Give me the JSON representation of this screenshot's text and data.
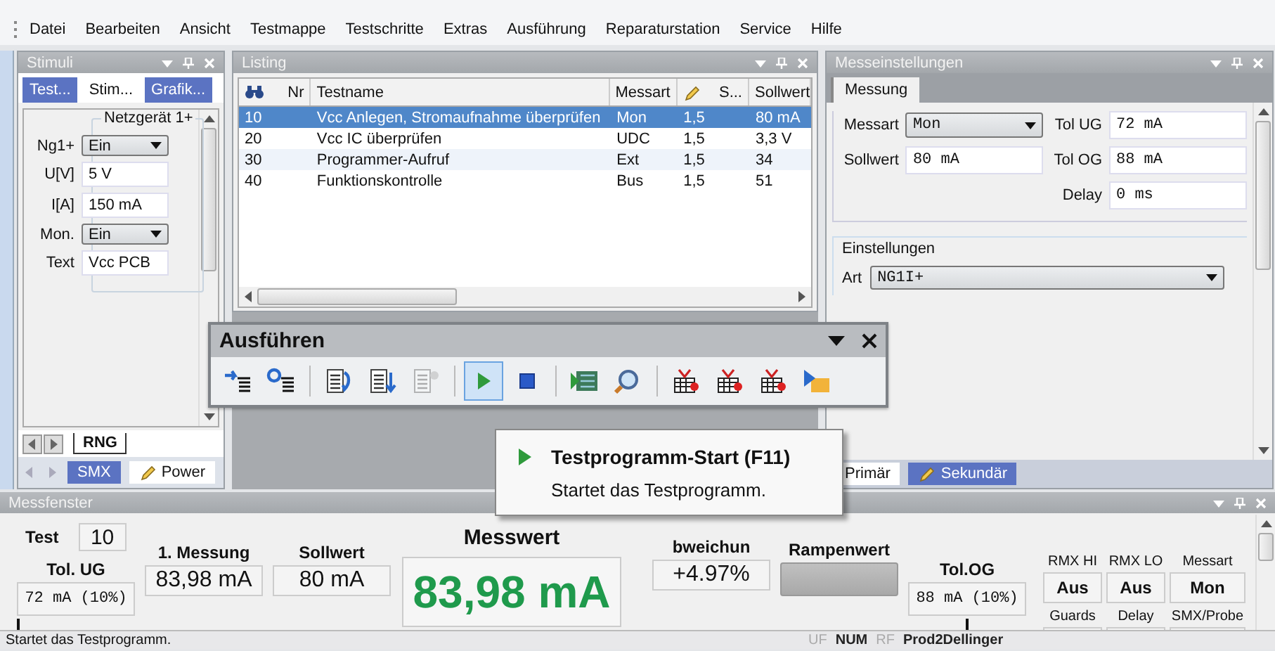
{
  "menu": [
    "Datei",
    "Bearbeiten",
    "Ansicht",
    "Testmappe",
    "Testschritte",
    "Extras",
    "Ausführung",
    "Reparaturstation",
    "Service",
    "Hilfe"
  ],
  "stimuli": {
    "title": "Stimuli",
    "tabs": [
      {
        "label": "Test...",
        "selected": false
      },
      {
        "label": "Stim...",
        "selected": true
      },
      {
        "label": "Grafik...",
        "selected": false
      }
    ],
    "group": "Netzgerät 1+",
    "fields": [
      {
        "kind": "dropdown",
        "label": "Ng1+",
        "value": "Ein"
      },
      {
        "kind": "text",
        "label": "U[V]",
        "value": "5 V"
      },
      {
        "kind": "text",
        "label": "I[A]",
        "value": "150 mA"
      },
      {
        "kind": "dropdown",
        "label": "Mon.",
        "value": "Ein"
      },
      {
        "kind": "text",
        "label": "Text",
        "value": "Vcc PCB"
      }
    ],
    "sheet_tabs": [
      {
        "label": "RNG",
        "selected": true
      }
    ],
    "bottom_tabs": [
      {
        "label": "SMX",
        "selected": false,
        "kind": "plain"
      },
      {
        "label": "Power",
        "selected": true,
        "kind": "edit"
      }
    ]
  },
  "listing": {
    "title": "Listing",
    "columns": [
      {
        "label": "Nr",
        "kind": "find"
      },
      {
        "label": "Testname",
        "kind": "plain"
      },
      {
        "label": "Messart",
        "kind": "plain"
      },
      {
        "label": "S...",
        "kind": "edit"
      },
      {
        "label": "Sollwert",
        "kind": "plain"
      }
    ],
    "rows": [
      {
        "cells": [
          "10",
          "Vcc Anlegen, Stromaufnahme überprüfen",
          "Mon",
          "1,5",
          "80 mA"
        ],
        "selected": true
      },
      {
        "cells": [
          "20",
          "Vcc IC überprüfen",
          "UDC",
          "1,5",
          "3,3 V"
        ],
        "selected": false
      },
      {
        "cells": [
          "30",
          "Programmer-Aufruf",
          "Ext",
          "1,5",
          "34"
        ],
        "selected": false
      },
      {
        "cells": [
          "40",
          "Funktionskontrolle",
          "Bus",
          "1,5",
          "51"
        ],
        "selected": false
      }
    ]
  },
  "settings": {
    "title": "Messeinstellungen",
    "tabs": [
      {
        "label": "Messung",
        "selected": true
      }
    ],
    "messart": {
      "label": "Messart",
      "value": "Mon"
    },
    "sollwert": {
      "label": "Sollwert",
      "value": "80 mA"
    },
    "tol_ug": {
      "label": "Tol UG",
      "value": "72 mA"
    },
    "tol_og": {
      "label": "Tol OG",
      "value": "88 mA"
    },
    "delay": {
      "label": "Delay",
      "value": "0 ms"
    },
    "group": "Einstellungen",
    "art": {
      "label": "Art",
      "value": "NG1I+"
    },
    "bottom_tabs": [
      {
        "label": "Primär",
        "selected": true,
        "kind": "plain"
      },
      {
        "label": "Sekundär",
        "selected": false,
        "kind": "edit"
      }
    ]
  },
  "toolbar": {
    "title": "Ausführen",
    "groups": [
      [
        {
          "kind": "step-arrow",
          "selected": false,
          "disabled": false
        },
        {
          "kind": "step-loop",
          "selected": false,
          "disabled": false
        }
      ],
      [
        {
          "kind": "doc-arrow",
          "selected": false,
          "disabled": false
        },
        {
          "kind": "doc-down",
          "selected": false,
          "disabled": false
        },
        {
          "kind": "doc-gear",
          "selected": false,
          "disabled": true
        }
      ],
      [
        {
          "kind": "play",
          "selected": true,
          "disabled": false
        },
        {
          "kind": "stop",
          "selected": false,
          "disabled": false
        }
      ],
      [
        {
          "kind": "board",
          "selected": false,
          "disabled": false
        },
        {
          "kind": "magnifier",
          "selected": false,
          "disabled": false
        }
      ],
      [
        {
          "kind": "stack",
          "selected": false,
          "disabled": false
        },
        {
          "kind": "stack",
          "selected": false,
          "disabled": false
        },
        {
          "kind": "stack",
          "selected": false,
          "disabled": false
        },
        {
          "kind": "folder",
          "selected": false,
          "disabled": false
        }
      ]
    ]
  },
  "tooltip": {
    "title": "Testprogramm-Start (F11)",
    "text": "Startet das Testprogramm."
  },
  "messfenster": {
    "title": "Messfenster",
    "test": {
      "label": "Test",
      "value": "10"
    },
    "tol_ug": {
      "label": "Tol. UG",
      "value": "72 mA (10%)"
    },
    "first": {
      "label": "1. Messung",
      "value": "83,98 mA"
    },
    "sollwert": {
      "label": "Sollwert",
      "value": "80 mA"
    },
    "messwert": {
      "label": "Messwert",
      "value": "83,98 mA"
    },
    "abweichung": {
      "label": "bweichun",
      "value": "+4.97%"
    },
    "rampe": {
      "label": "Rampenwert"
    },
    "tol_og": {
      "label": "Tol.OG",
      "value": "88 mA (10%)"
    },
    "flags": [
      {
        "label": "RMX HI",
        "value": "Aus"
      },
      {
        "label": "RMX LO",
        "value": "Aus"
      },
      {
        "label": "Messart",
        "value": "Mon"
      }
    ],
    "flags2": [
      {
        "label": "Guards"
      },
      {
        "label": "Delay"
      },
      {
        "label": "SMX/Probe"
      }
    ]
  },
  "status": {
    "message": "Startet das Testprogramm.",
    "indicators": [
      {
        "label": "UF",
        "on": false
      },
      {
        "label": "NUM",
        "on": true
      },
      {
        "label": "RF",
        "on": false
      },
      {
        "label": "Prod2Dellinger",
        "on": true
      }
    ]
  }
}
